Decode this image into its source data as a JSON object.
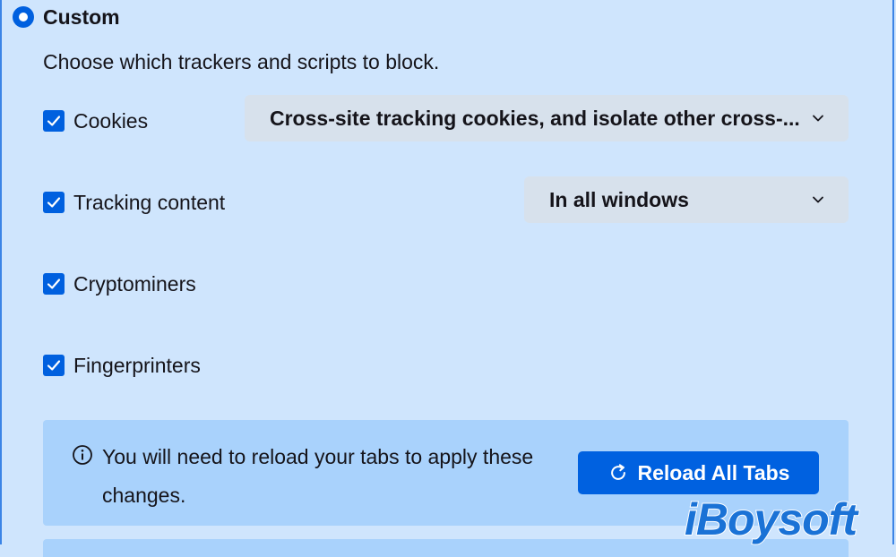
{
  "custom_option": {
    "label": "Custom",
    "selected": true
  },
  "description": "Choose which trackers and scripts to block.",
  "trackers": [
    {
      "label": "Cookies",
      "checked": true
    },
    {
      "label": "Tracking content",
      "checked": true
    },
    {
      "label": "Cryptominers",
      "checked": true
    },
    {
      "label": "Fingerprinters",
      "checked": true
    }
  ],
  "cookies_select": {
    "value": "Cross-site tracking cookies, and isolate other cross-...",
    "icon": "chevron-down-icon"
  },
  "tracking_select": {
    "value": "In all windows",
    "icon": "chevron-down-icon"
  },
  "notice": {
    "text": "You will need to reload your tabs to apply these changes.",
    "icon": "info-icon",
    "button_label": "Reload All Tabs",
    "button_icon": "reload-icon"
  },
  "watermark": "iBoysoft",
  "colors": {
    "background": "#cfe5fd",
    "accent": "#0060df",
    "notice_bg": "#a9d2fc",
    "select_bg": "#d7e1ec"
  }
}
